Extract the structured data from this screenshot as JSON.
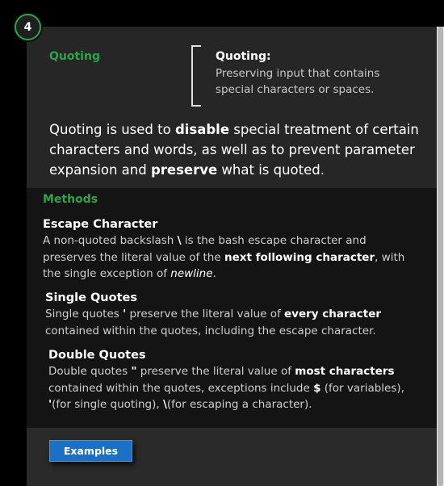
{
  "step_badge": "4",
  "header": {
    "section_label": "Quoting",
    "definition_title": "Quoting:",
    "definition_body": "Preserving input that contains special characters or spaces."
  },
  "intro": {
    "t1": "Quoting is used to ",
    "b1": "disable",
    "t2": " special treatment of certain characters and words, as well as to prevent parameter expansion and ",
    "b2": "preserve",
    "t3": " what is quoted."
  },
  "methods": {
    "label": "Methods",
    "escape": {
      "title": "Escape Character",
      "t1": "A non-quoted backslash ",
      "b1": "\\",
      "t2": " is the bash escape character and preserves the literal value of the ",
      "b2": "next following character",
      "t3": ", with the single exception of ",
      "i1": "newline",
      "t4": "."
    },
    "single": {
      "title": "Single Quotes",
      "t1": "Single quotes ",
      "b1": "'",
      "t2": " preserve the literal value of ",
      "b2": "every character",
      "t3": " contained within the quotes, including the escape character."
    },
    "double": {
      "title": "Double Quotes",
      "t1": "Double quotes ",
      "b1": "\"",
      "t2": " preserve the literal value of ",
      "b2": "most characters",
      "t3": " contained within the quotes, exceptions include ",
      "b3": "$",
      "t4": " (for variables), ",
      "b4": "'",
      "t5": "(for single quoting), ",
      "b5": "\\",
      "t6": "(for escaping a character)."
    }
  },
  "examples_button": "Examples",
  "colors": {
    "accent_green": "#2fa34a",
    "button_blue": "#1c70c4"
  }
}
